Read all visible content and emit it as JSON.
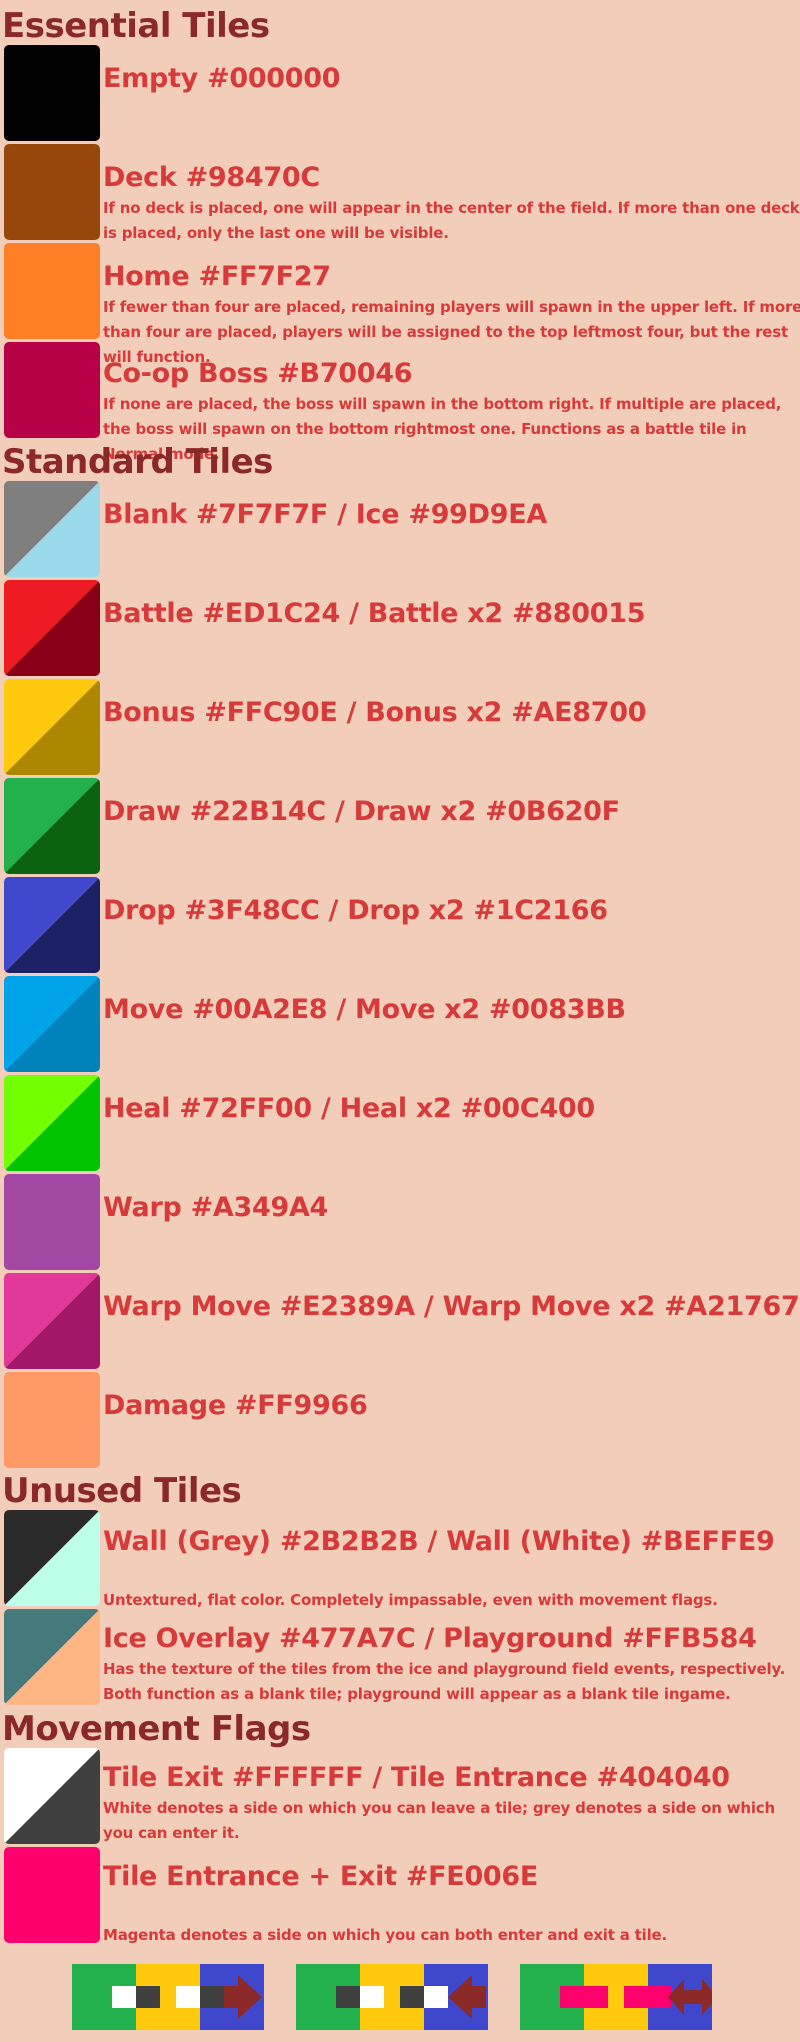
{
  "sections": {
    "essential": "Essential Tiles",
    "standard": "Standard Tiles",
    "unused": "Unused Tiles",
    "flags": "Movement Flags"
  },
  "tiles": [
    {
      "title": "Empty #000000",
      "desc": "",
      "colors": [
        "#000000"
      ]
    },
    {
      "title": "Deck #98470C",
      "desc": "If no deck is placed, one will appear in the center of the field. If more than one deck is placed, only the last one will be visible.",
      "colors": [
        "#98470C"
      ]
    },
    {
      "title": "Home #FF7F27",
      "desc": "If fewer than four are placed, remaining players will spawn in the upper left. If more than four are placed, players will be assigned to the top leftmost four, but the rest will function.",
      "colors": [
        "#FF7F27"
      ]
    },
    {
      "title": "Co-op Boss #B70046",
      "desc": "If none are placed, the boss will spawn in the bottom right. If multiple are placed, the boss will spawn on the bottom rightmost one. Functions as a battle tile in Normal mode.",
      "colors": [
        "#B70046"
      ]
    },
    {
      "title": "Blank #7F7F7F / Ice #99D9EA",
      "desc": "",
      "colors": [
        "#7F7F7F",
        "#99D9EA"
      ]
    },
    {
      "title": "Battle #ED1C24 / Battle x2 #880015",
      "desc": "",
      "colors": [
        "#ED1C24",
        "#880015"
      ]
    },
    {
      "title": "Bonus #FFC90E / Bonus x2 #AE8700",
      "desc": "",
      "colors": [
        "#FFC90E",
        "#AE8700"
      ]
    },
    {
      "title": "Draw #22B14C / Draw x2 #0B620F",
      "desc": "",
      "colors": [
        "#22B14C",
        "#0B620F"
      ]
    },
    {
      "title": "Drop #3F48CC / Drop x2 #1C2166",
      "desc": "",
      "colors": [
        "#3F48CC",
        "#1C2166"
      ]
    },
    {
      "title": "Move #00A2E8 / Move x2 #0083BB",
      "desc": "",
      "colors": [
        "#00A2E8",
        "#0083BB"
      ]
    },
    {
      "title": "Heal #72FF00 / Heal x2 #00C400",
      "desc": "",
      "colors": [
        "#72FF00",
        "#00C400"
      ]
    },
    {
      "title": "Warp #A349A4",
      "desc": "",
      "colors": [
        "#A349A4"
      ]
    },
    {
      "title": "Warp Move #E2389A / Warp Move x2 #A21767",
      "desc": "",
      "colors": [
        "#E2389A",
        "#A21767"
      ]
    },
    {
      "title": "Damage #FF9966",
      "desc": "",
      "colors": [
        "#FF9966"
      ]
    },
    {
      "title": "Wall (Grey) #2B2B2B / Wall (White) #BEFFE9",
      "desc": "Untextured, flat color. Completely impassable, even with movement flags.",
      "colors": [
        "#2B2B2B",
        "#BEFFE9"
      ]
    },
    {
      "title": "Ice Overlay #477A7C / Playground #FFB584",
      "desc": "Has the texture of the tiles from the ice and playground field events, respectively. Both function as a blank tile; playground will appear as a blank tile ingame.",
      "colors": [
        "#477A7C",
        "#FFB584"
      ]
    },
    {
      "title": "Tile Exit #FFFFFF / Tile Entrance #404040",
      "desc": "White denotes a side on which you can leave a tile; grey denotes a side on which you can enter it.",
      "colors": [
        "#FFFFFF",
        "#404040"
      ]
    },
    {
      "title": "Tile Entrance + Exit #FE006E",
      "desc": "Magenta denotes a side on which you can both enter and exit a tile.",
      "colors": [
        "#FE006E"
      ]
    }
  ],
  "diagrams": [
    {
      "name": "exit-flow",
      "markers": [
        "#FFFFFF",
        "#404040",
        "#FFFFFF",
        "#404040"
      ],
      "arrow": "right"
    },
    {
      "name": "entrance-flow",
      "markers": [
        "#404040",
        "#FFFFFF",
        "#404040",
        "#FFFFFF"
      ],
      "arrow": "left"
    },
    {
      "name": "both-flow",
      "markers": [
        "#FE006E",
        "#FE006E"
      ],
      "arrow": "both"
    }
  ],
  "diagram_colors": {
    "green": "#22B14C",
    "yellow": "#FFC90E",
    "blue": "#3F48CC",
    "arrow": "#8B2828"
  }
}
